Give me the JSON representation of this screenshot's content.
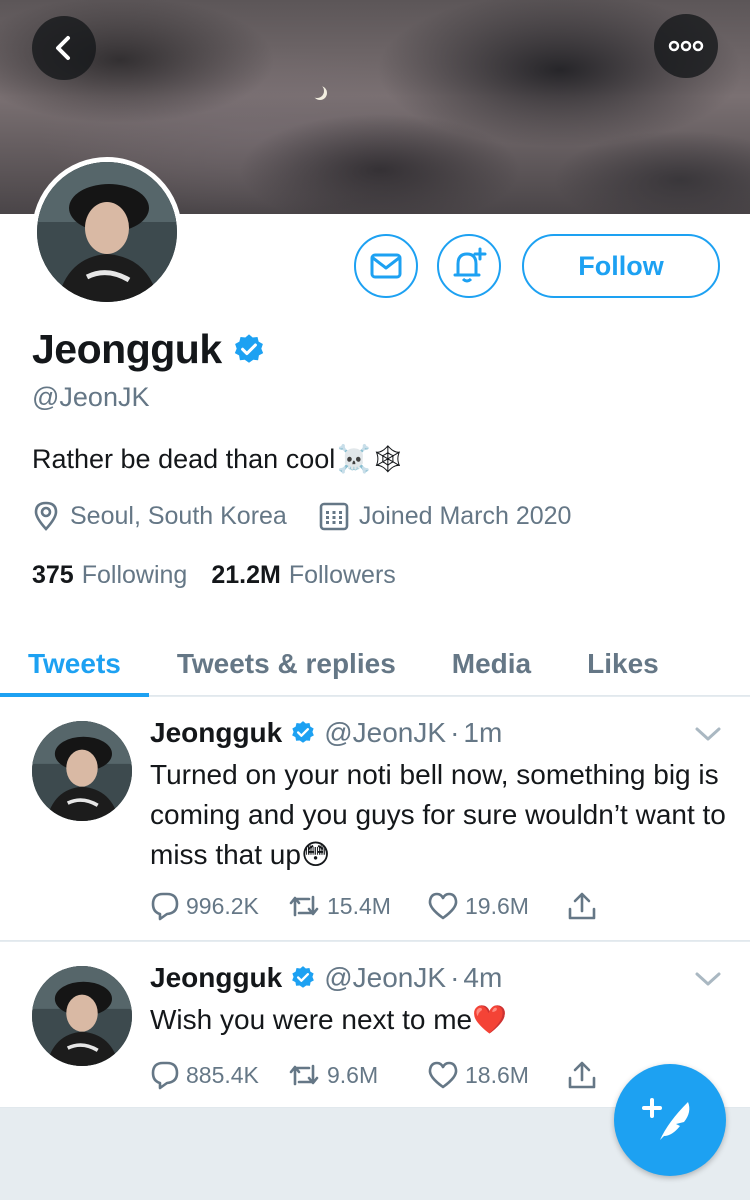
{
  "header": {
    "back_icon": "chevron-left-icon",
    "more_icon": "more-horizontal-icon"
  },
  "profile": {
    "name": "Jeongguk",
    "handle": "@JeonJK",
    "bio": "Rather be dead than cool",
    "bio_emoji": "☠️🕸",
    "location": "Seoul, South Korea",
    "joined": "Joined March 2020",
    "following_count": "375",
    "following_label": "Following",
    "followers_count": "21.2M",
    "followers_label": "Followers",
    "follow_label": "Follow"
  },
  "tabs": [
    {
      "label": "Tweets",
      "active": true
    },
    {
      "label": "Tweets & replies",
      "active": false
    },
    {
      "label": "Media",
      "active": false
    },
    {
      "label": "Likes",
      "active": false
    }
  ],
  "tweets": [
    {
      "name": "Jeongguk",
      "handle": "@JeonJK",
      "time": "1m",
      "text": "Turned on your noti bell now, something big is coming and you guys for sure wouldn’t want to miss that up",
      "emoji": "😳",
      "replies": "996.2K",
      "retweets": "15.4M",
      "likes": "19.6M"
    },
    {
      "name": "Jeongguk",
      "handle": "@JeonJK",
      "time": "4m",
      "text": "Wish you were next to me",
      "emoji": "❤️",
      "replies": "885.4K",
      "retweets": "9.6M",
      "likes": "18.6M"
    }
  ],
  "colors": {
    "accent": "#1da1f2",
    "muted": "#657786",
    "text": "#14171a"
  }
}
